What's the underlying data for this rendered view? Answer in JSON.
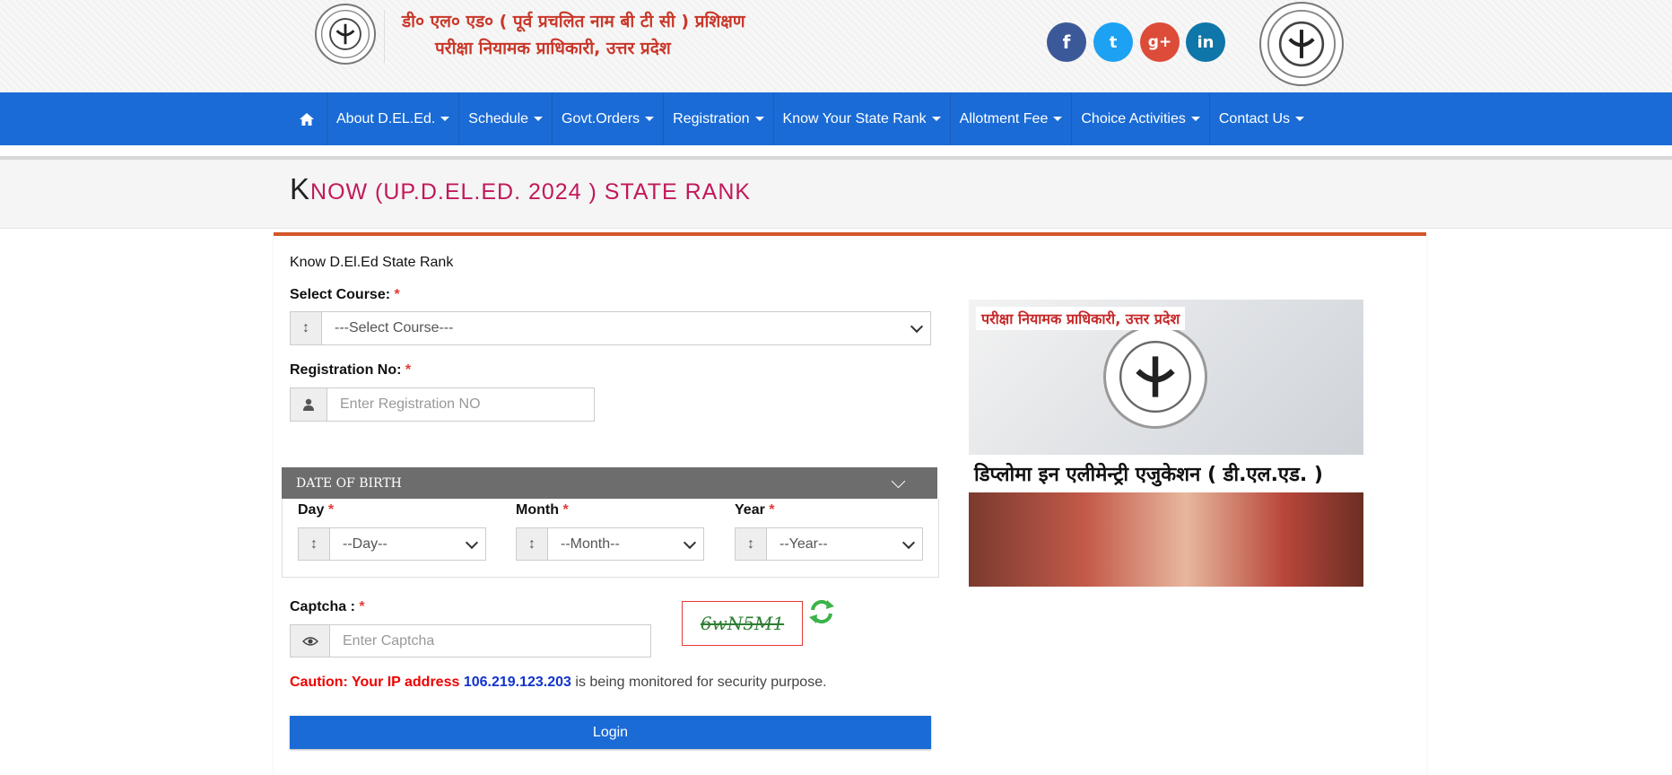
{
  "header": {
    "brand_line1": "डी० एल० एड० ( पूर्व प्रचलित नाम बी टी सी ) प्रशिक्षण",
    "brand_line2": "परीक्षा नियामक प्राधिकारी, उत्तर प्रदेश",
    "social": [
      {
        "name": "facebook",
        "glyph": "f",
        "color": "#3b5998"
      },
      {
        "name": "twitter",
        "glyph": "t",
        "color": "#1da1f2"
      },
      {
        "name": "googleplus",
        "glyph": "g+",
        "color": "#dd4b39"
      },
      {
        "name": "linkedin",
        "glyph": "in",
        "color": "#0e76a8"
      }
    ]
  },
  "nav": {
    "home_icon": "home-icon",
    "items": [
      "About D.EL.Ed.",
      "Schedule",
      "Govt.Orders",
      "Registration",
      "Know Your State Rank",
      "Allotment Fee",
      "Choice Activities",
      "Contact Us"
    ]
  },
  "page": {
    "title_first": "K",
    "title_rest": "NOW (UP.D.EL.ED. 2024 ) STATE RANK"
  },
  "form": {
    "subtitle": "Know D.El.Ed State Rank",
    "course_label": "Select Course:",
    "course_value": "---Select Course---",
    "reg_label": "Registration No:",
    "reg_placeholder": "Enter Registration NO",
    "dob_heading": "DATE OF BIRTH",
    "day_label": "Day",
    "day_value": "--Day--",
    "month_label": "Month",
    "month_value": "--Month--",
    "year_label": "Year",
    "year_value": "--Year--",
    "captcha_label": "Captcha :",
    "captcha_placeholder": "Enter Captcha",
    "captcha_text": "6wN5M1",
    "required_mark": "*",
    "caution_label": "Caution: Your IP address",
    "ip_address": "106.219.123.203",
    "caution_rest": "is being monitored for security purpose.",
    "login_label": "Login"
  },
  "promo": {
    "heading": "परीक्षा नियामक प्राधिकारी, उत्तर प्रदेश",
    "subheading": "डिप्लोमा इन एलीमेन्ट्री एजुकेशन ( डी.एल.एड. )"
  },
  "colors": {
    "nav_blue": "#1a6bd6",
    "title_pink": "#c2185b",
    "panel_accent": "#d4552a",
    "caution_red": "#e00000",
    "ip_blue": "#1033cc"
  }
}
